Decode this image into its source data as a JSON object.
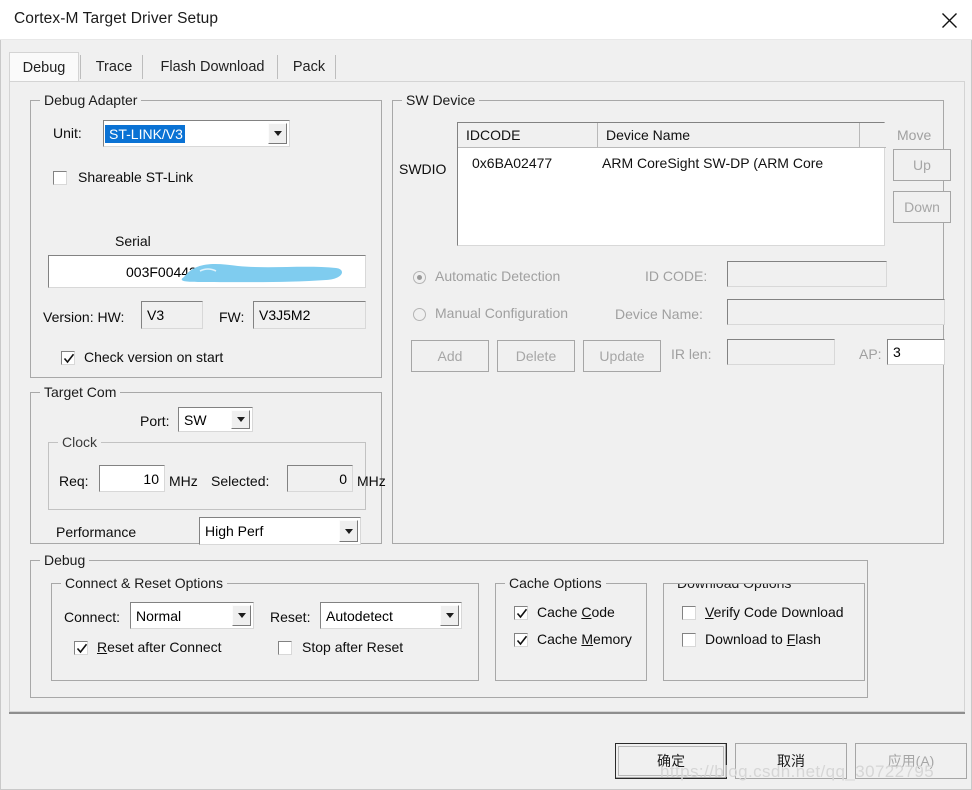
{
  "window": {
    "title": "Cortex-M Target Driver Setup",
    "close_icon": "close-icon"
  },
  "tabs": [
    {
      "label": "Debug",
      "active": true
    },
    {
      "label": "Trace",
      "active": false
    },
    {
      "label": "Flash Download",
      "active": false
    },
    {
      "label": "Pack",
      "active": false
    }
  ],
  "debug_adapter": {
    "group_label": "Debug Adapter",
    "unit_label": "Unit:",
    "unit_value": "ST-LINK/V3",
    "shareable_label": "Shareable ST-Link",
    "shareable_checked": false,
    "serial_label": "Serial",
    "serial_value": "003F00443",
    "version_label": "Version: HW:",
    "hw_value": "V3",
    "fw_label": "FW:",
    "fw_value": "V3J5M2",
    "check_version_label": "Check version on start",
    "check_version_checked": true
  },
  "target_com": {
    "group_label": "Target Com",
    "port_label": "Port:",
    "port_value": "SW",
    "clock_label": "Clock",
    "req_label": "Req:",
    "req_value": "10",
    "req_unit": "MHz",
    "selected_label": "Selected:",
    "selected_value": "0",
    "selected_unit": "MHz",
    "performance_label": "Performance",
    "performance_value": "High Perf"
  },
  "sw_device": {
    "group_label": "SW Device",
    "swdio_label": "SWDIO",
    "columns": [
      "IDCODE",
      "Device Name"
    ],
    "rows": [
      {
        "idcode": "0x6BA02477",
        "device_name": "ARM CoreSight SW-DP (ARM Core"
      }
    ],
    "move_label": "Move",
    "up_label": "Up",
    "down_label": "Down",
    "automatic_detection_label": "Automatic Detection",
    "manual_configuration_label": "Manual Configuration",
    "detection_mode": "automatic",
    "id_code_label": "ID CODE:",
    "id_code_value": "",
    "device_name_label": "Device Name:",
    "device_name_value": "",
    "ir_len_label": "IR len:",
    "ir_len_value": "",
    "ap_label": "AP:",
    "ap_value": "3",
    "add_label": "Add",
    "delete_label": "Delete",
    "update_label": "Update"
  },
  "debug_section": {
    "group_label": "Debug",
    "connect_reset": {
      "group_label": "Connect & Reset Options",
      "connect_label": "Connect:",
      "connect_value": "Normal",
      "reset_label": "Reset:",
      "reset_value": "Autodetect",
      "reset_after_connect_label": "Reset after Connect",
      "reset_after_connect_checked": true,
      "stop_after_reset_label": "Stop after Reset",
      "stop_after_reset_checked": false
    },
    "cache_options": {
      "group_label": "Cache Options",
      "cache_code_label": "Cache Code",
      "cache_code_checked": true,
      "cache_memory_label": "Cache Memory",
      "cache_memory_checked": true
    },
    "download_options": {
      "group_label": "Download Options",
      "verify_code_download_label": "Verify Code Download",
      "verify_code_download_checked": false,
      "download_to_flash_label": "Download to Flash",
      "download_to_flash_checked": false
    }
  },
  "footer": {
    "ok_label": "确定",
    "cancel_label": "取消",
    "apply_label": "应用(A)",
    "apply_enabled": false
  },
  "watermark": "https://blog.csdn.net/qq_30722795",
  "colors": {
    "dialog_background": "#f0f0f0",
    "selection_blue": "#0a72d4",
    "redaction_blue": "#7fccef",
    "disabled_text": "#a0a0a0"
  }
}
